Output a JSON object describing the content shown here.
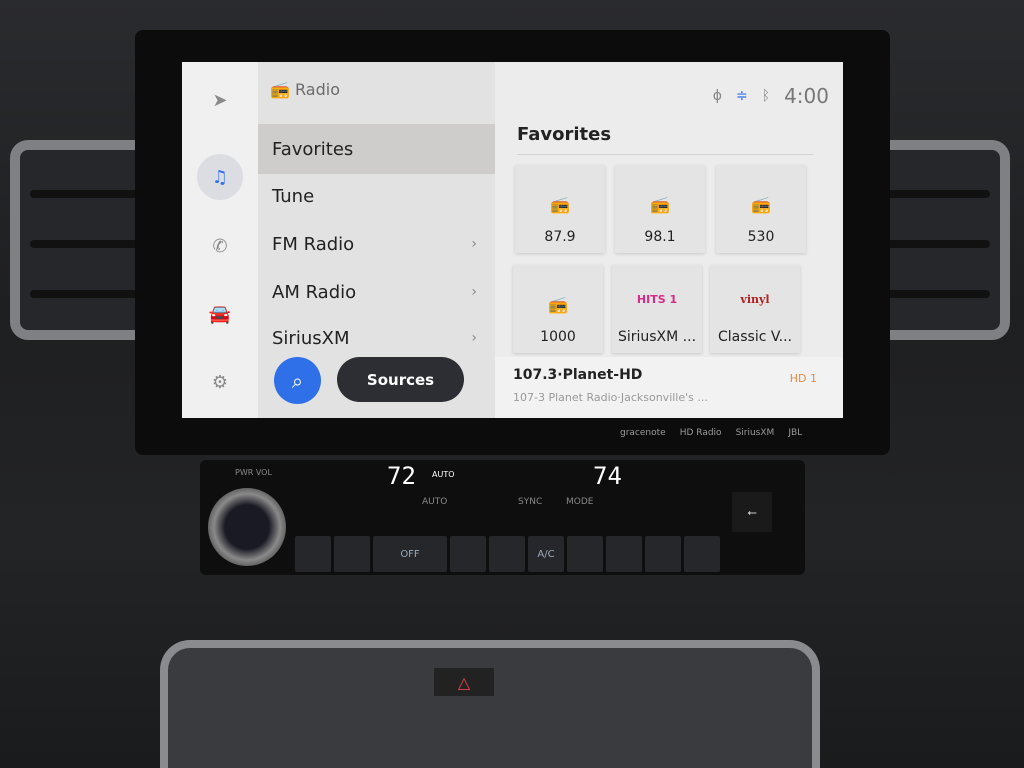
{
  "rail": {
    "icons": [
      "navigation-icon",
      "music-icon",
      "phone-icon",
      "car-icon",
      "settings-icon"
    ]
  },
  "list": {
    "header": "Radio",
    "items": [
      {
        "label": "Favorites",
        "selected": true
      },
      {
        "label": "Tune"
      },
      {
        "label": "FM Radio",
        "chevron": true
      },
      {
        "label": "AM Radio",
        "chevron": true
      },
      {
        "label": "SiriusXM",
        "chevron": true
      }
    ],
    "sources_label": "Sources"
  },
  "status": {
    "clock": "4:00",
    "icons": [
      "wireless-charging-icon",
      "voice-assistant-icon",
      "bluetooth-icon"
    ]
  },
  "favorites": {
    "title": "Favorites",
    "tiles": [
      {
        "label": "87.9",
        "icon": "radio-icon"
      },
      {
        "label": "98.1",
        "icon": "radio-icon"
      },
      {
        "label": "530",
        "icon": "radio-icon"
      },
      {
        "label": "1000",
        "icon": "radio-icon"
      },
      {
        "label": "SiriusXM ...",
        "logo": "SiriusXM Hits 1"
      },
      {
        "label": "Classic V...",
        "logo": "Classic vinyl"
      }
    ]
  },
  "now_playing": {
    "title": "107.3·Planet-HD",
    "subtitle": "107-3 Planet Radio·Jacksonville's ...",
    "hd": "HD 1",
    "hd_color": "#e08a4a"
  },
  "brands": [
    "gracenote",
    "HD Radio",
    "SiriusXM",
    "JBL"
  ],
  "climate": {
    "left_temp": "72",
    "right_temp": "74",
    "auto_indicator": "AUTO",
    "pwr_vol": "PWR VOL",
    "labels": [
      "AUTO",
      "SYNC",
      "MODE"
    ],
    "buttons": [
      "OFF",
      "A/C"
    ]
  },
  "colors": {
    "accent": "#2f6fe8",
    "sources_bg": "#2c2e33"
  }
}
